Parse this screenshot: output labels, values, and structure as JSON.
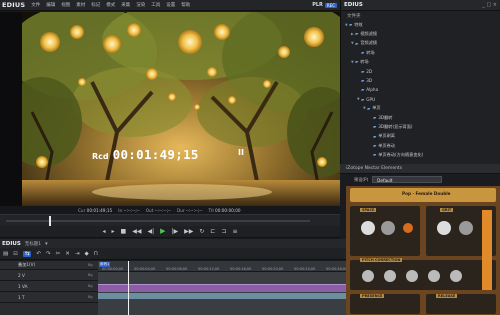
{
  "menubar": {
    "app_name": "EDIUS",
    "items": [
      "文件",
      "编辑",
      "视图",
      "素材",
      "标记",
      "模式",
      "采集",
      "渲染",
      "工具",
      "设置",
      "帮助"
    ],
    "plr_label": "PLR",
    "rec_badge": "REC"
  },
  "preview": {
    "rcd_label": "Rcd",
    "timecode": "00:01:49;15",
    "pause_symbol": "II"
  },
  "info_bar": {
    "cur_label": "Cur",
    "cur_value": "00:01:49;15",
    "in_label": "In",
    "in_value": "--:--:--;--",
    "out_label": "Out",
    "out_value": "--:--:--;--",
    "dur_label": "Dur",
    "dur_value": "--:--:--;--",
    "ttl_label": "Ttl",
    "ttl_value": "00:00:00;00"
  },
  "transport": {
    "progress": 0.14
  },
  "timeline": {
    "app_name": "EDIUS",
    "project_name": "无标题1",
    "sequence_tab": "序列1",
    "ruler_position": "00:00:00;00",
    "ruler_labels": [
      "00:00:00;00",
      "00:00:04;00",
      "00:00:08;00",
      "00:00:12;00",
      "00:00:16;00",
      "00:00:20;00",
      "00:00:24;00",
      "00:00:28;00"
    ],
    "tracks": [
      {
        "id": "1",
        "name": "叠加1(V)",
        "tag": "Bg"
      },
      {
        "id": "2 V",
        "name": "",
        "tag": "Bg"
      },
      {
        "id": "1 VA",
        "name": "",
        "tag": "Bg"
      },
      {
        "id": "1 T",
        "name": "",
        "tag": "Bg"
      }
    ]
  },
  "browser": {
    "app_name": "EDIUS",
    "window_buttons": "_ □ ×",
    "section": "文件夹",
    "tree": [
      {
        "label": "特效",
        "level": 0,
        "arrow": "▼"
      },
      {
        "label": "视频滤镜",
        "level": 1,
        "arrow": "▶"
      },
      {
        "label": "音频滤镜",
        "level": 1,
        "arrow": "▼"
      },
      {
        "label": "转场",
        "level": 2,
        "arrow": ""
      },
      {
        "label": "转场",
        "level": 1,
        "arrow": "▼"
      },
      {
        "label": "2D",
        "level": 2,
        "arrow": ""
      },
      {
        "label": "3D",
        "level": 2,
        "arrow": ""
      },
      {
        "label": "Alpha",
        "level": 2,
        "arrow": ""
      },
      {
        "label": "GPU",
        "level": 2,
        "arrow": "▼"
      },
      {
        "label": "单页",
        "level": 3,
        "arrow": "▼"
      },
      {
        "label": "3D翻转",
        "level": 4,
        "arrow": ""
      },
      {
        "label": "3D翻转(显示背面)",
        "level": 4,
        "arrow": ""
      },
      {
        "label": "单页剥离",
        "level": 4,
        "arrow": ""
      },
      {
        "label": "单页卷动",
        "level": 4,
        "arrow": ""
      },
      {
        "label": "单页卷动(方向随意变化)",
        "level": 4,
        "arrow": ""
      }
    ]
  },
  "nectar": {
    "title": "iZotope Nectar Elements",
    "preset_label": "预设(P)",
    "preset_value": "Default",
    "mode_label": "Pop · Female Double",
    "labels": [
      "SPACE",
      "GRIT",
      "PITCH CORRECTION",
      "PRESENCE",
      "RELEASE"
    ]
  }
}
